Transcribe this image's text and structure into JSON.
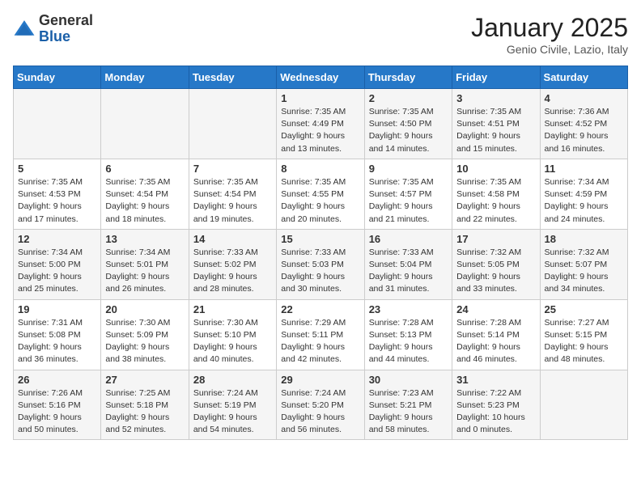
{
  "header": {
    "logo_general": "General",
    "logo_blue": "Blue",
    "month_title": "January 2025",
    "subtitle": "Genio Civile, Lazio, Italy"
  },
  "days_of_week": [
    "Sunday",
    "Monday",
    "Tuesday",
    "Wednesday",
    "Thursday",
    "Friday",
    "Saturday"
  ],
  "weeks": [
    [
      {
        "day": "",
        "info": ""
      },
      {
        "day": "",
        "info": ""
      },
      {
        "day": "",
        "info": ""
      },
      {
        "day": "1",
        "info": "Sunrise: 7:35 AM\nSunset: 4:49 PM\nDaylight: 9 hours and 13 minutes."
      },
      {
        "day": "2",
        "info": "Sunrise: 7:35 AM\nSunset: 4:50 PM\nDaylight: 9 hours and 14 minutes."
      },
      {
        "day": "3",
        "info": "Sunrise: 7:35 AM\nSunset: 4:51 PM\nDaylight: 9 hours and 15 minutes."
      },
      {
        "day": "4",
        "info": "Sunrise: 7:36 AM\nSunset: 4:52 PM\nDaylight: 9 hours and 16 minutes."
      }
    ],
    [
      {
        "day": "5",
        "info": "Sunrise: 7:35 AM\nSunset: 4:53 PM\nDaylight: 9 hours and 17 minutes."
      },
      {
        "day": "6",
        "info": "Sunrise: 7:35 AM\nSunset: 4:54 PM\nDaylight: 9 hours and 18 minutes."
      },
      {
        "day": "7",
        "info": "Sunrise: 7:35 AM\nSunset: 4:54 PM\nDaylight: 9 hours and 19 minutes."
      },
      {
        "day": "8",
        "info": "Sunrise: 7:35 AM\nSunset: 4:55 PM\nDaylight: 9 hours and 20 minutes."
      },
      {
        "day": "9",
        "info": "Sunrise: 7:35 AM\nSunset: 4:57 PM\nDaylight: 9 hours and 21 minutes."
      },
      {
        "day": "10",
        "info": "Sunrise: 7:35 AM\nSunset: 4:58 PM\nDaylight: 9 hours and 22 minutes."
      },
      {
        "day": "11",
        "info": "Sunrise: 7:34 AM\nSunset: 4:59 PM\nDaylight: 9 hours and 24 minutes."
      }
    ],
    [
      {
        "day": "12",
        "info": "Sunrise: 7:34 AM\nSunset: 5:00 PM\nDaylight: 9 hours and 25 minutes."
      },
      {
        "day": "13",
        "info": "Sunrise: 7:34 AM\nSunset: 5:01 PM\nDaylight: 9 hours and 26 minutes."
      },
      {
        "day": "14",
        "info": "Sunrise: 7:33 AM\nSunset: 5:02 PM\nDaylight: 9 hours and 28 minutes."
      },
      {
        "day": "15",
        "info": "Sunrise: 7:33 AM\nSunset: 5:03 PM\nDaylight: 9 hours and 30 minutes."
      },
      {
        "day": "16",
        "info": "Sunrise: 7:33 AM\nSunset: 5:04 PM\nDaylight: 9 hours and 31 minutes."
      },
      {
        "day": "17",
        "info": "Sunrise: 7:32 AM\nSunset: 5:05 PM\nDaylight: 9 hours and 33 minutes."
      },
      {
        "day": "18",
        "info": "Sunrise: 7:32 AM\nSunset: 5:07 PM\nDaylight: 9 hours and 34 minutes."
      }
    ],
    [
      {
        "day": "19",
        "info": "Sunrise: 7:31 AM\nSunset: 5:08 PM\nDaylight: 9 hours and 36 minutes."
      },
      {
        "day": "20",
        "info": "Sunrise: 7:30 AM\nSunset: 5:09 PM\nDaylight: 9 hours and 38 minutes."
      },
      {
        "day": "21",
        "info": "Sunrise: 7:30 AM\nSunset: 5:10 PM\nDaylight: 9 hours and 40 minutes."
      },
      {
        "day": "22",
        "info": "Sunrise: 7:29 AM\nSunset: 5:11 PM\nDaylight: 9 hours and 42 minutes."
      },
      {
        "day": "23",
        "info": "Sunrise: 7:28 AM\nSunset: 5:13 PM\nDaylight: 9 hours and 44 minutes."
      },
      {
        "day": "24",
        "info": "Sunrise: 7:28 AM\nSunset: 5:14 PM\nDaylight: 9 hours and 46 minutes."
      },
      {
        "day": "25",
        "info": "Sunrise: 7:27 AM\nSunset: 5:15 PM\nDaylight: 9 hours and 48 minutes."
      }
    ],
    [
      {
        "day": "26",
        "info": "Sunrise: 7:26 AM\nSunset: 5:16 PM\nDaylight: 9 hours and 50 minutes."
      },
      {
        "day": "27",
        "info": "Sunrise: 7:25 AM\nSunset: 5:18 PM\nDaylight: 9 hours and 52 minutes."
      },
      {
        "day": "28",
        "info": "Sunrise: 7:24 AM\nSunset: 5:19 PM\nDaylight: 9 hours and 54 minutes."
      },
      {
        "day": "29",
        "info": "Sunrise: 7:24 AM\nSunset: 5:20 PM\nDaylight: 9 hours and 56 minutes."
      },
      {
        "day": "30",
        "info": "Sunrise: 7:23 AM\nSunset: 5:21 PM\nDaylight: 9 hours and 58 minutes."
      },
      {
        "day": "31",
        "info": "Sunrise: 7:22 AM\nSunset: 5:23 PM\nDaylight: 10 hours and 0 minutes."
      },
      {
        "day": "",
        "info": ""
      }
    ]
  ]
}
